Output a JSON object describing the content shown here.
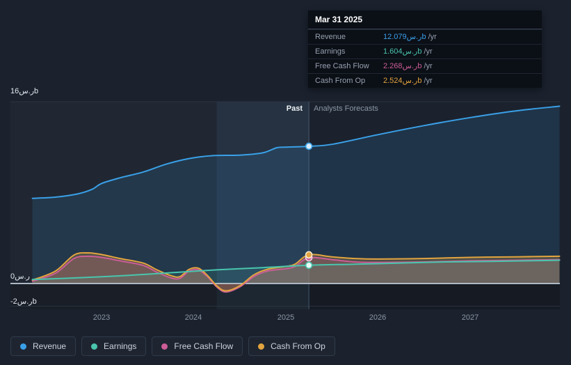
{
  "tooltip": {
    "date": "Mar 31 2025",
    "rows": [
      {
        "label": "Revenue",
        "value": "12.079ر.سb",
        "suffix": "/yr",
        "color": "#3aa0e8"
      },
      {
        "label": "Earnings",
        "value": "1.604ر.سb",
        "suffix": "/yr",
        "color": "#49c5ad"
      },
      {
        "label": "Free Cash Flow",
        "value": "2.268ر.سb",
        "suffix": "/yr",
        "color": "#cc5d96"
      },
      {
        "label": "Cash From Op",
        "value": "2.524ر.سb",
        "suffix": "/yr",
        "color": "#e3a43f"
      }
    ]
  },
  "sections": {
    "past": "Past",
    "forecast": "Analysts Forecasts"
  },
  "axis": {
    "y_top": "16ر.سb",
    "y_zero": "0ر.س",
    "y_neg": "-2ر.سb",
    "x_ticks": [
      "2023",
      "2024",
      "2025",
      "2026",
      "2027"
    ]
  },
  "legend": [
    {
      "label": "Revenue",
      "color": "#3aa0e8"
    },
    {
      "label": "Earnings",
      "color": "#49c5ad"
    },
    {
      "label": "Free Cash Flow",
      "color": "#cc5d96"
    },
    {
      "label": "Cash From Op",
      "color": "#e3a43f"
    }
  ],
  "chart_data": {
    "type": "line",
    "unit": "SAR billions (ر.سb)",
    "ylim": [
      -2,
      16
    ],
    "x_range": [
      2022.25,
      2027.97
    ],
    "x_ticks": [
      2023,
      2024,
      2025,
      2026,
      2027
    ],
    "divider_x": 2025.25,
    "divider_date": "Mar 31 2025",
    "highlight_band": [
      2024.25,
      2025.25
    ],
    "gridlines": [
      16,
      0,
      -2
    ],
    "legend_position": "bottom",
    "series": [
      {
        "name": "Revenue",
        "color": "#3aa0e8",
        "fill_opacity": 0.14,
        "marker": {
          "value": 12.079,
          "fill": "#d9ecfa",
          "stroke": "#3aa0e8"
        },
        "x": [
          2022.25,
          2022.5,
          2022.75,
          2022.9,
          2023.0,
          2023.2,
          2023.45,
          2023.7,
          2023.95,
          2024.2,
          2024.5,
          2024.75,
          2024.9,
          2025.0,
          2025.25,
          2025.5,
          2026.0,
          2026.5,
          2027.0,
          2027.5,
          2027.97
        ],
        "values": [
          7.5,
          7.6,
          7.9,
          8.3,
          8.8,
          9.3,
          9.8,
          10.5,
          11.0,
          11.25,
          11.3,
          11.5,
          11.95,
          12.0,
          12.079,
          12.25,
          13.1,
          13.9,
          14.6,
          15.2,
          15.6
        ]
      },
      {
        "name": "Free Cash Flow",
        "color": "#cc5d96",
        "fill_opacity": 0.25,
        "marker": {
          "value": 2.268,
          "fill": "#cc5d96",
          "stroke": "#f1d6e5"
        },
        "x": [
          2022.25,
          2022.5,
          2022.7,
          2022.85,
          2023.0,
          2023.2,
          2023.45,
          2023.6,
          2023.75,
          2023.85,
          2023.95,
          2024.05,
          2024.15,
          2024.25,
          2024.35,
          2024.5,
          2024.65,
          2024.8,
          2025.0,
          2025.1,
          2025.25,
          2025.5,
          2025.75,
          2026.0,
          2026.5,
          2027.0,
          2027.5,
          2027.97
        ],
        "values": [
          0.2,
          0.9,
          2.2,
          2.4,
          2.3,
          2.0,
          1.6,
          1.0,
          0.5,
          0.45,
          1.1,
          1.2,
          0.6,
          -0.3,
          -0.75,
          -0.3,
          0.6,
          1.1,
          1.3,
          1.5,
          2.268,
          2.1,
          1.9,
          1.85,
          1.9,
          2.0,
          2.05,
          2.1
        ]
      },
      {
        "name": "Cash From Op",
        "color": "#e3a43f",
        "fill_opacity": 0.25,
        "marker": {
          "value": 2.524,
          "fill": "#e3a43f",
          "stroke": "#f7ead2"
        },
        "x": [
          2022.25,
          2022.5,
          2022.7,
          2022.85,
          2023.0,
          2023.2,
          2023.45,
          2023.6,
          2023.75,
          2023.85,
          2023.95,
          2024.05,
          2024.15,
          2024.25,
          2024.35,
          2024.5,
          2024.65,
          2024.8,
          2025.0,
          2025.1,
          2025.25,
          2025.5,
          2025.75,
          2026.0,
          2026.5,
          2027.0,
          2027.5,
          2027.97
        ],
        "values": [
          0.3,
          1.1,
          2.5,
          2.7,
          2.55,
          2.2,
          1.8,
          1.2,
          0.7,
          0.6,
          1.25,
          1.35,
          0.7,
          -0.2,
          -0.65,
          -0.2,
          0.75,
          1.25,
          1.5,
          1.7,
          2.524,
          2.35,
          2.2,
          2.15,
          2.2,
          2.3,
          2.35,
          2.4
        ]
      },
      {
        "name": "Earnings",
        "color": "#49c5ad",
        "fill_opacity": 0.12,
        "marker": {
          "value": 1.604,
          "fill": "#eafaf6",
          "stroke": "#49c5ad"
        },
        "x": [
          2022.25,
          2022.75,
          2023.25,
          2023.75,
          2024.25,
          2024.75,
          2025.25,
          2025.75,
          2026.25,
          2026.75,
          2027.25,
          2027.97
        ],
        "values": [
          0.35,
          0.5,
          0.7,
          0.95,
          1.2,
          1.4,
          1.604,
          1.7,
          1.8,
          1.9,
          1.95,
          2.05
        ]
      }
    ]
  }
}
